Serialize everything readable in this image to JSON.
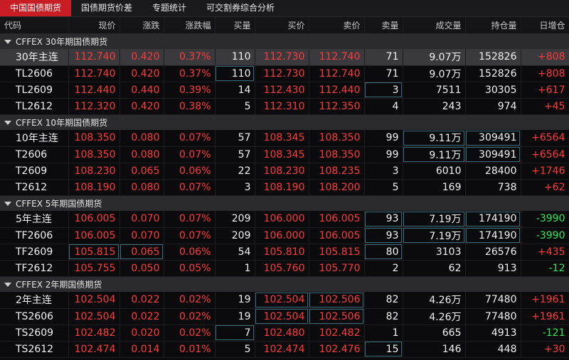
{
  "tabs": [
    {
      "label": "中国国债期货",
      "active": true
    },
    {
      "label": "国债期货价差",
      "active": false
    },
    {
      "label": "专题统计",
      "active": false
    },
    {
      "label": "可交割券综合分析",
      "active": false
    }
  ],
  "columns": [
    "代码",
    "现价",
    "涨跌",
    "涨跌幅",
    "买量",
    "买价",
    "卖价",
    "卖量",
    "成交量",
    "持仓量",
    "日增仓"
  ],
  "groups": [
    {
      "title": "CFFEX 30年期国债期货",
      "rows": [
        {
          "code": "30年主连",
          "price": "112.740",
          "chg": "0.420",
          "pct": "0.37%",
          "bidv": "110",
          "bid": "112.730",
          "ask": "112.740",
          "askv": "71",
          "vol": "9.07万",
          "oi": "152826",
          "doi": "+808"
        },
        {
          "code": "TL2606",
          "price": "112.740",
          "chg": "0.420",
          "pct": "0.37%",
          "bidv": "110",
          "bid": "112.730",
          "ask": "112.740",
          "askv": "71",
          "vol": "9.07万",
          "oi": "152826",
          "doi": "+808"
        },
        {
          "code": "TL2609",
          "price": "112.440",
          "chg": "0.440",
          "pct": "0.39%",
          "bidv": "14",
          "bid": "112.430",
          "ask": "112.440",
          "askv": "3",
          "vol": "7511",
          "oi": "30305",
          "doi": "+617"
        },
        {
          "code": "TL2612",
          "price": "112.320",
          "chg": "0.420",
          "pct": "0.38%",
          "bidv": "5",
          "bid": "112.310",
          "ask": "112.350",
          "askv": "4",
          "vol": "243",
          "oi": "974",
          "doi": "+45"
        }
      ]
    },
    {
      "title": "CFFEX 10年期国债期货",
      "rows": [
        {
          "code": "10年主连",
          "price": "108.350",
          "chg": "0.080",
          "pct": "0.07%",
          "bidv": "57",
          "bid": "108.345",
          "ask": "108.350",
          "askv": "99",
          "vol": "9.11万",
          "oi": "309491",
          "doi": "+6564"
        },
        {
          "code": "T2606",
          "price": "108.350",
          "chg": "0.080",
          "pct": "0.07%",
          "bidv": "57",
          "bid": "108.345",
          "ask": "108.350",
          "askv": "99",
          "vol": "9.11万",
          "oi": "309491",
          "doi": "+6564"
        },
        {
          "code": "T2609",
          "price": "108.230",
          "chg": "0.065",
          "pct": "0.06%",
          "bidv": "22",
          "bid": "108.230",
          "ask": "108.235",
          "askv": "3",
          "vol": "6010",
          "oi": "28400",
          "doi": "+1746"
        },
        {
          "code": "T2612",
          "price": "108.190",
          "chg": "0.080",
          "pct": "0.07%",
          "bidv": "3",
          "bid": "108.190",
          "ask": "108.200",
          "askv": "5",
          "vol": "169",
          "oi": "738",
          "doi": "+62"
        }
      ]
    },
    {
      "title": "CFFEX 5年期国债期货",
      "rows": [
        {
          "code": "5年主连",
          "price": "106.005",
          "chg": "0.070",
          "pct": "0.07%",
          "bidv": "209",
          "bid": "106.000",
          "ask": "106.005",
          "askv": "93",
          "vol": "7.19万",
          "oi": "174190",
          "doi": "-3990"
        },
        {
          "code": "TF2606",
          "price": "106.005",
          "chg": "0.070",
          "pct": "0.07%",
          "bidv": "209",
          "bid": "106.000",
          "ask": "106.005",
          "askv": "93",
          "vol": "7.19万",
          "oi": "174190",
          "doi": "-3990"
        },
        {
          "code": "TF2609",
          "price": "105.815",
          "chg": "0.065",
          "pct": "0.06%",
          "bidv": "54",
          "bid": "105.810",
          "ask": "105.815",
          "askv": "80",
          "vol": "3103",
          "oi": "26576",
          "doi": "+435"
        },
        {
          "code": "TF2612",
          "price": "105.755",
          "chg": "0.050",
          "pct": "0.05%",
          "bidv": "1",
          "bid": "105.760",
          "ask": "105.770",
          "askv": "2",
          "vol": "62",
          "oi": "913",
          "doi": "-12"
        }
      ]
    },
    {
      "title": "CFFEX 2年期国债期货",
      "rows": [
        {
          "code": "2年主连",
          "price": "102.504",
          "chg": "0.022",
          "pct": "0.02%",
          "bidv": "19",
          "bid": "102.504",
          "ask": "102.506",
          "askv": "82",
          "vol": "4.26万",
          "oi": "77480",
          "doi": "+1961"
        },
        {
          "code": "TS2606",
          "price": "102.504",
          "chg": "0.022",
          "pct": "0.02%",
          "bidv": "19",
          "bid": "102.504",
          "ask": "102.506",
          "askv": "82",
          "vol": "4.26万",
          "oi": "77480",
          "doi": "+1961"
        },
        {
          "code": "TS2609",
          "price": "102.482",
          "chg": "0.020",
          "pct": "0.02%",
          "bidv": "7",
          "bid": "102.480",
          "ask": "102.482",
          "askv": "1",
          "vol": "665",
          "oi": "4913",
          "doi": "-121"
        },
        {
          "code": "TS2612",
          "price": "102.474",
          "chg": "0.014",
          "pct": "0.01%",
          "bidv": "5",
          "bid": "102.474",
          "ask": "102.476",
          "askv": "15",
          "vol": "146",
          "oi": "448",
          "doi": "+30"
        }
      ]
    }
  ],
  "selected_row": "30年主连",
  "highlight_cells": {
    "TL2606": [
      "bidv"
    ],
    "TL2609": [
      "askv"
    ],
    "10年主连": [
      "vol",
      "oi"
    ],
    "T2606": [
      "vol",
      "oi"
    ],
    "5年主连": [
      "askv",
      "vol",
      "oi"
    ],
    "TF2606": [
      "askv",
      "vol",
      "oi"
    ],
    "TF2609": [
      "price",
      "chg",
      "askv"
    ],
    "2年主连": [
      "bid",
      "ask"
    ],
    "TS2606": [
      "bid",
      "ask"
    ],
    "TS2609": [
      "bidv"
    ],
    "TS2612": [
      "askv"
    ]
  },
  "colors": {
    "accent": "#c81d25",
    "up": "#ff3b3b",
    "down": "#2ee85c",
    "neutral": "#f2f2f2"
  }
}
